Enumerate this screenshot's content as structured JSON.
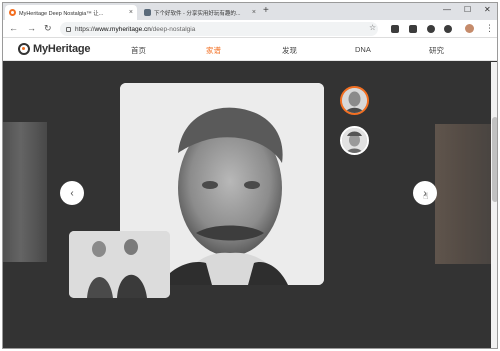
{
  "browser": {
    "tabs": [
      {
        "title": "MyHeritage Deep Nostalgia™ 让...",
        "active": true
      },
      {
        "title": "下个好软件 - 分享实用好玩有趣的...",
        "active": false
      }
    ],
    "new_tab_symbol": "+",
    "window_controls": [
      "—",
      "☐",
      "✕"
    ],
    "url": {
      "scheme": "https://",
      "host": "www.myheritage.cn",
      "path": "/deep-nostalgia"
    }
  },
  "site": {
    "logo_text": "MyHeritage",
    "nav": [
      {
        "label": "首页",
        "active": false
      },
      {
        "label": "家谱",
        "active": true
      },
      {
        "label": "发现",
        "active": false
      },
      {
        "label": "DNA",
        "active": false
      },
      {
        "label": "研究",
        "active": false
      }
    ]
  },
  "stage": {
    "prev_symbol": "‹",
    "next_symbol": "›"
  },
  "colors": {
    "brand": "#f36f21",
    "stage_bg": "#333333"
  },
  "icons": {
    "back": "arrow-left",
    "forward": "arrow-right",
    "reload": "reload",
    "lock": "lock",
    "star": "star",
    "menu": "more-vert"
  }
}
